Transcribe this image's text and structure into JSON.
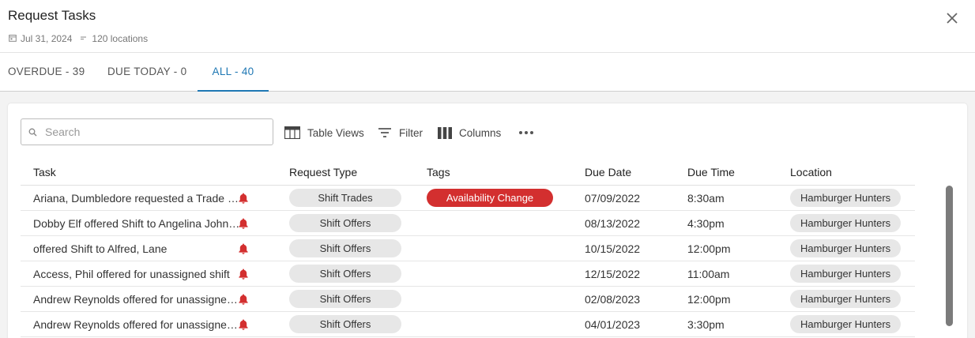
{
  "header": {
    "title": "Request Tasks",
    "date": "Jul 31, 2024",
    "locations": "120 locations"
  },
  "tabs": [
    {
      "label": "OVERDUE - 39",
      "active": false
    },
    {
      "label": "DUE TODAY - 0",
      "active": false
    },
    {
      "label": "ALL - 40",
      "active": true
    }
  ],
  "toolbar": {
    "search_placeholder": "Search",
    "table_views_label": "Table Views",
    "filter_label": "Filter",
    "columns_label": "Columns"
  },
  "table": {
    "columns": [
      "Task",
      "Request Type",
      "Tags",
      "Due Date",
      "Due Time",
      "Location"
    ],
    "rows": [
      {
        "task": "Ariana, Dumbledore requested a Trade with Alfred",
        "request_type": "Shift Trades",
        "tag": "Availability Change",
        "due_date": "07/09/2022",
        "due_time": "8:30am",
        "location": "Hamburger Hunters"
      },
      {
        "task": "Dobby Elf offered Shift to Angelina Johnson",
        "request_type": "Shift Offers",
        "tag": "",
        "due_date": "08/13/2022",
        "due_time": "4:30pm",
        "location": "Hamburger Hunters"
      },
      {
        "task": "offered Shift to Alfred, Lane",
        "request_type": "Shift Offers",
        "tag": "",
        "due_date": "10/15/2022",
        "due_time": "12:00pm",
        "location": "Hamburger Hunters"
      },
      {
        "task": "Access, Phil offered for unassigned shift",
        "request_type": "Shift Offers",
        "tag": "",
        "due_date": "12/15/2022",
        "due_time": "11:00am",
        "location": "Hamburger Hunters"
      },
      {
        "task": "Andrew Reynolds offered for unassigned shift",
        "request_type": "Shift Offers",
        "tag": "",
        "due_date": "02/08/2023",
        "due_time": "12:00pm",
        "location": "Hamburger Hunters"
      },
      {
        "task": "Andrew Reynolds offered for unassigned shift",
        "request_type": "Shift Offers",
        "tag": "",
        "due_date": "04/01/2023",
        "due_time": "3:30pm",
        "location": "Hamburger Hunters"
      }
    ]
  },
  "colors": {
    "accent": "#1f78b4",
    "alert": "#d32f2f",
    "chip": "#e7e7e7"
  },
  "icons": [
    "calendar-icon",
    "location-icon",
    "close-icon",
    "search-icon",
    "table-views-icon",
    "filter-icon",
    "columns-icon",
    "more-icon",
    "bell-alert-icon"
  ]
}
